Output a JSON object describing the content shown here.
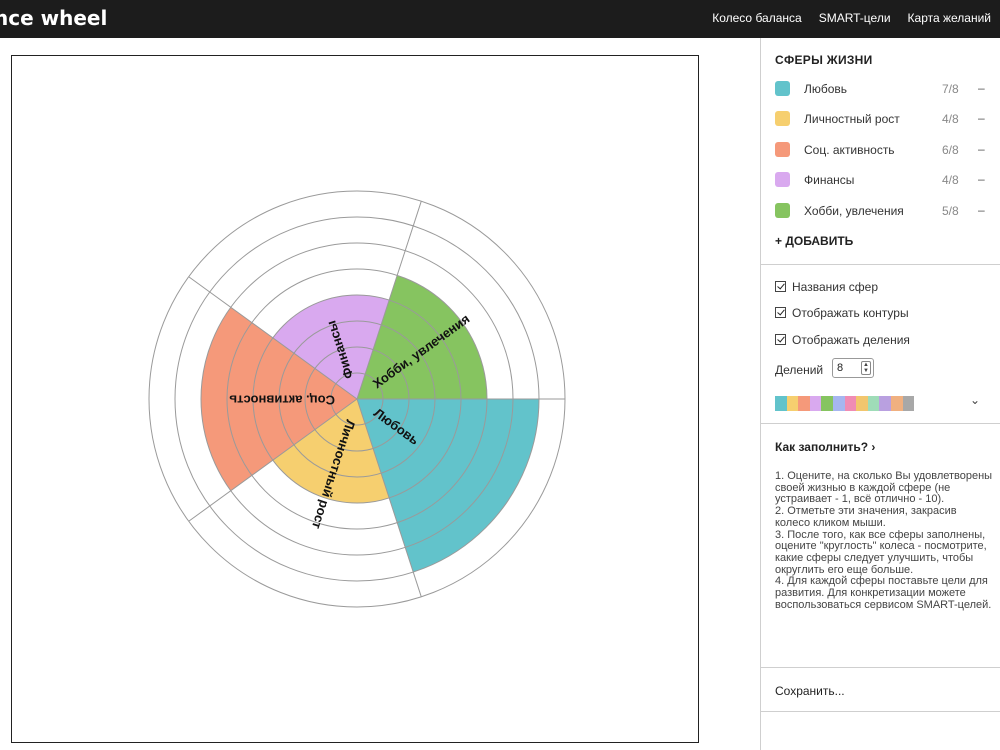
{
  "app": {
    "brand": "nce wheel"
  },
  "nav": [
    "Колесо баланса",
    "SMART-цели",
    "Карта желаний"
  ],
  "chart_data": {
    "type": "polar-area",
    "max": 8,
    "segments": [
      {
        "name": "Любовь",
        "value": 7,
        "max": 8,
        "color": "#62c3cb"
      },
      {
        "name": "Личностный рост",
        "value": 4,
        "max": 8,
        "color": "#f6cf6f"
      },
      {
        "name": "Соц. активность",
        "value": 6,
        "max": 8,
        "color": "#f5997a"
      },
      {
        "name": "Финансы",
        "value": 4,
        "max": 8,
        "color": "#d9a9ef"
      },
      {
        "name": "Хобби, увлечения",
        "value": 5,
        "max": 8,
        "color": "#86c460"
      }
    ]
  },
  "sidebar": {
    "spheres_title": "СФЕРЫ ЖИЗНИ",
    "spheres": [
      {
        "name": "Любовь",
        "score": "7/8",
        "color": "#62c3cb"
      },
      {
        "name": "Личностный рост",
        "score": "4/8",
        "color": "#f6cf6f"
      },
      {
        "name": "Соц. активность",
        "score": "6/8",
        "color": "#f5997a"
      },
      {
        "name": "Финансы",
        "score": "4/8",
        "color": "#d9a9ef"
      },
      {
        "name": "Хобби, увлечения",
        "score": "5/8",
        "color": "#86c460"
      }
    ],
    "remove_symbol": "–",
    "add_label": "+ ДОБАВИТЬ",
    "options": {
      "show_names": "Названия сфер",
      "show_contours": "Отображать контуры",
      "show_divisions": "Отображать деления",
      "divisions_label": "Делений",
      "divisions_value": "8"
    },
    "palette": [
      "#62c3cb",
      "#f6cf6f",
      "#f5997a",
      "#d9a9ef",
      "#86c460",
      "#a6b6f0",
      "#f08cb4",
      "#f2c66e",
      "#9fdcb8",
      "#b9a0e0",
      "#f0b080",
      "#a8a8a8"
    ],
    "how_to_fill": "Как заполнить?  ›",
    "instructions": [
      "1. Оцените, на сколько Вы удовлетворены своей жизнью в каждой сфере (не устраивает - 1, всё отлично - 10).",
      "2. Отметьте эти значения, закрасив колесо кликом мыши.",
      "3. После того, как все сферы заполнены, оцените \"круглость\" колеса - посмотрите, какие сферы следует улучшить, чтобы округлить его еще больше.",
      "4. Для каждой сферы поставьте цели для развития. Для конкретизации можете воспользоваться сервисом SMART-целей."
    ],
    "save_label": "Сохранить..."
  }
}
